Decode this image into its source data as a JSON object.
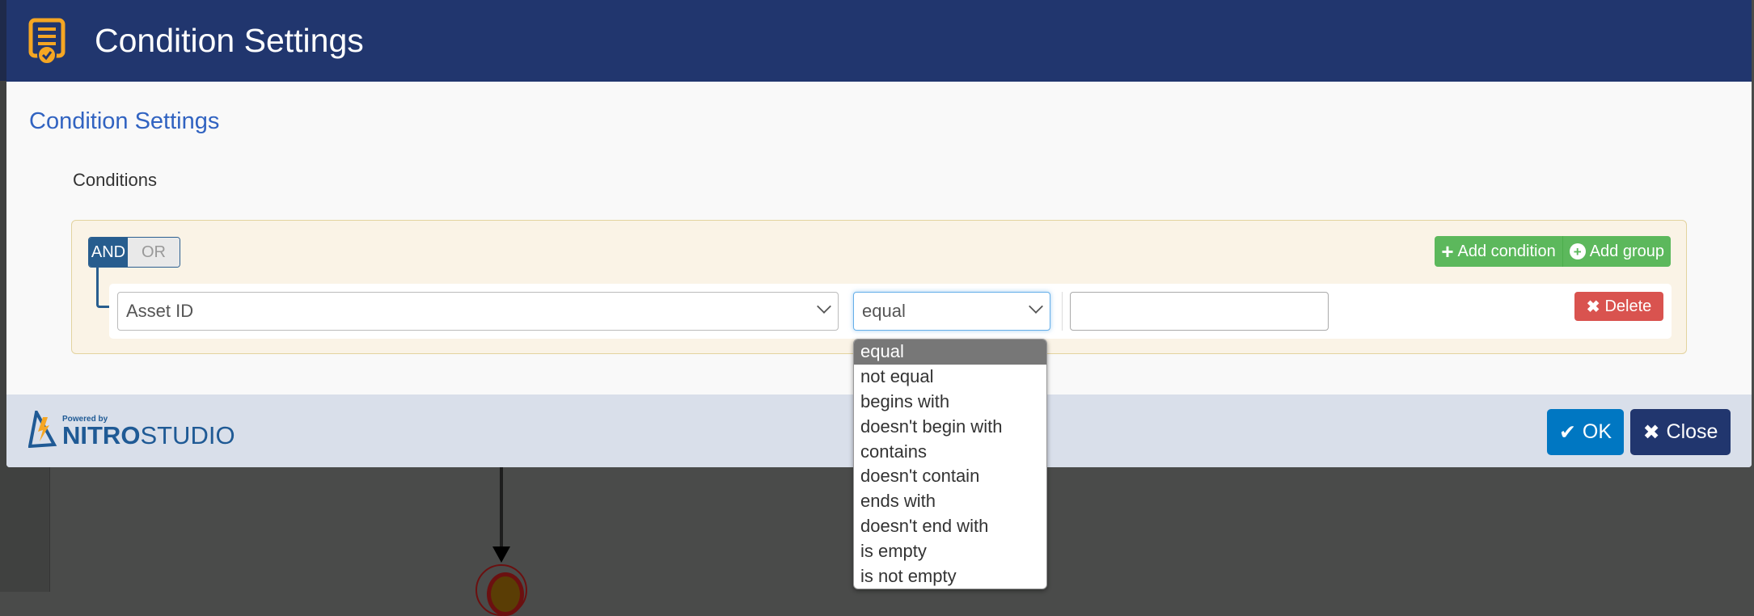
{
  "modal": {
    "title": "Condition Settings",
    "subtitle": "Condition Settings",
    "conditions_label": "Conditions"
  },
  "group": {
    "and_label": "AND",
    "or_label": "OR",
    "active": "AND",
    "add_condition_label": "Add condition",
    "add_group_label": "Add group"
  },
  "rule": {
    "field": "Asset ID",
    "operator": "equal",
    "value": "",
    "delete_label": "Delete"
  },
  "operator_options": [
    "equal",
    "not equal",
    "begins with",
    "doesn't begin with",
    "contains",
    "doesn't contain",
    "ends with",
    "doesn't end with",
    "is empty",
    "is not empty"
  ],
  "footer": {
    "powered_by": "Powered by",
    "brand_bold": "NITRO",
    "brand_light": "STUDIO",
    "ok_label": "OK",
    "close_label": "Close"
  },
  "colors": {
    "header": "#21366e",
    "accent": "#3163c1",
    "success": "#5cb85c",
    "danger": "#d9534f",
    "ok": "#0077c2",
    "icon": "#f5a623"
  }
}
